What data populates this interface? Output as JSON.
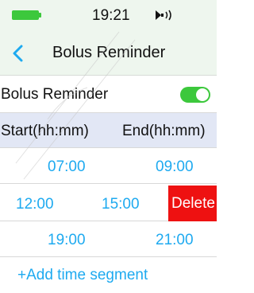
{
  "status_bar": {
    "time": "19:21",
    "battery_icon": "battery-full-icon",
    "sound_icon": "speaker-volume-icon"
  },
  "nav": {
    "back_icon": "chevron-left-icon",
    "title": "Bolus Reminder"
  },
  "setting": {
    "label": "Bolus Reminder",
    "enabled": true
  },
  "columns": {
    "start": "Start(hh:mm)",
    "end": "End(hh:mm)"
  },
  "segments": [
    {
      "start": "07:00",
      "end": "09:00"
    },
    {
      "start": "12:00",
      "end": "15:00",
      "delete_label": "Delete"
    },
    {
      "start": "19:00",
      "end": "21:00"
    }
  ],
  "add_segment_label": "+Add time segment",
  "colors": {
    "accent": "#1eaaf0",
    "toggle_on": "#3cc83c",
    "delete": "#ee1111",
    "header_bg": "#eef6ee",
    "column_header_bg": "#e2e7f5"
  }
}
